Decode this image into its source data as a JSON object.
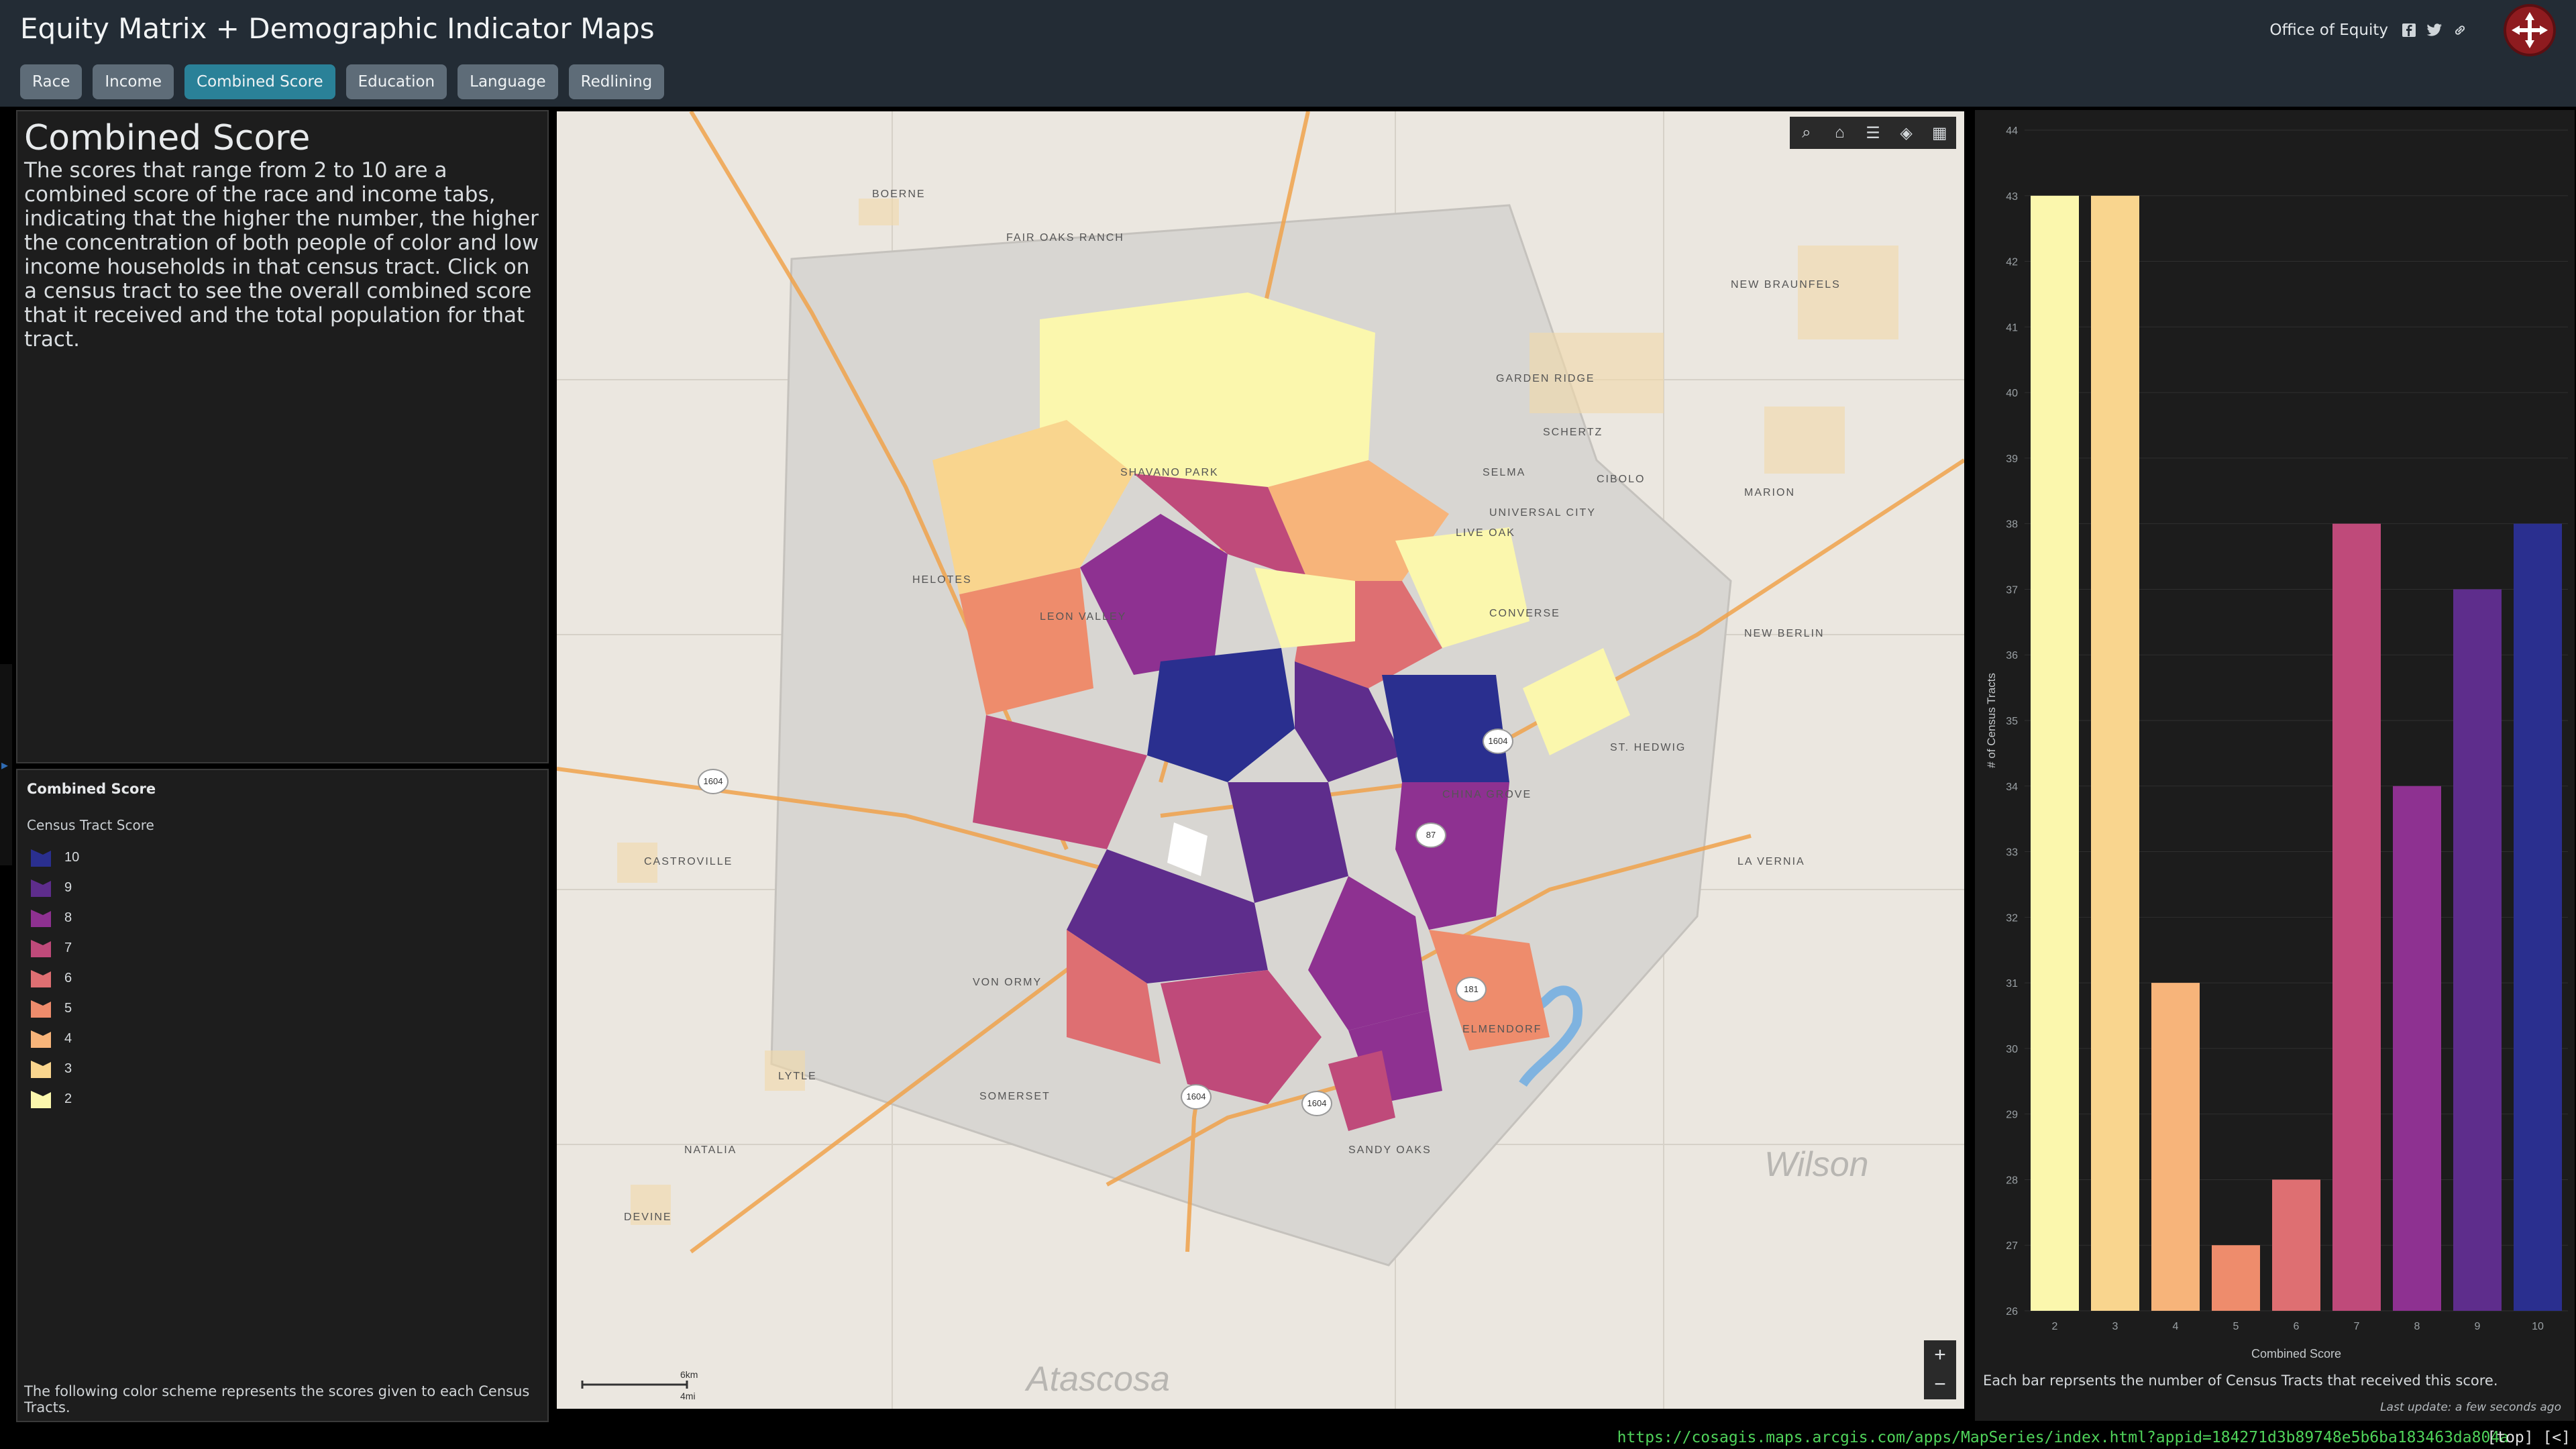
{
  "header": {
    "title": "Equity Matrix + Demographic Indicator Maps",
    "org": "Office of Equity",
    "tabs": [
      {
        "label": "Race"
      },
      {
        "label": "Income"
      },
      {
        "label": "Combined Score",
        "active": true
      },
      {
        "label": "Education"
      },
      {
        "label": "Language"
      },
      {
        "label": "Redlining"
      }
    ],
    "social_icons": [
      "facebook-icon",
      "twitter-icon",
      "link-icon"
    ]
  },
  "description": {
    "title": "Combined Score",
    "text": "The scores that range from 2 to 10 are a combined score of the race and income tabs, indicating that the higher the number, the higher the concentration of both people of color and low income households in that census tract. Click on a census tract to see the overall combined score that it received and the total population for that tract."
  },
  "legend": {
    "title": "Combined Score",
    "subtitle": "Census Tract Score",
    "items": [
      {
        "label": "10",
        "color": "#2a2f8f"
      },
      {
        "label": "9",
        "color": "#5e2d8c"
      },
      {
        "label": "8",
        "color": "#8e3191"
      },
      {
        "label": "7",
        "color": "#bf4a7a"
      },
      {
        "label": "6",
        "color": "#de6f72"
      },
      {
        "label": "5",
        "color": "#ee8c6c"
      },
      {
        "label": "4",
        "color": "#f7b47a"
      },
      {
        "label": "3",
        "color": "#f9d58e"
      },
      {
        "label": "2",
        "color": "#fbf7ad"
      }
    ],
    "footer": "The following color scheme represents the scores given to each Census Tracts."
  },
  "map": {
    "labels": [
      "BOERNE",
      "FAIR OAKS RANCH",
      "HELOTES",
      "SHAVANO PARK",
      "LEON VALLEY",
      "CASTROVILLE",
      "LYTLE",
      "NATALIA",
      "DEVINE",
      "SOMERSET",
      "VON ORMY",
      "SANDY OAKS",
      "ELMENDORF",
      "CHINA GROVE",
      "ST. HEDWIG",
      "CONVERSE",
      "LIVE OAK",
      "UNIVERSAL CITY",
      "SELMA",
      "SCHERTZ",
      "CIBOLO",
      "GARDEN RIDGE",
      "NEW BRAUNFELS",
      "MARION",
      "NEW BERLIN",
      "LA VERNIA"
    ],
    "county_labels": [
      "Wilson",
      "Atascosa"
    ],
    "highway_shields": [
      "1604",
      "1604",
      "1604",
      "1604",
      "181",
      "87"
    ],
    "scale": {
      "km": "6km",
      "mi": "4mi"
    },
    "toolbar": [
      "search-icon",
      "home-icon",
      "list-icon",
      "layers-icon",
      "basemap-icon"
    ],
    "zoom_in": "+",
    "zoom_out": "−"
  },
  "chart": {
    "note": "Each bar reprsents the number of Census Tracts that received this score.",
    "update": "Last update: a few seconds ago"
  },
  "chart_data": {
    "type": "bar",
    "categories": [
      "2",
      "3",
      "4",
      "5",
      "6",
      "7",
      "8",
      "9",
      "10"
    ],
    "values": [
      43,
      43,
      31,
      27,
      28,
      38,
      34,
      37,
      38
    ],
    "colors": [
      "#fbf7ad",
      "#f9d58e",
      "#f7b47a",
      "#ee8c6c",
      "#de6f72",
      "#bf4a7a",
      "#8e3191",
      "#5e2d8c",
      "#2a2f8f"
    ],
    "xlabel": "Combined Score",
    "ylabel": "# of Census Tracts",
    "ylim": [
      26,
      44
    ],
    "yticks": [
      26,
      27,
      28,
      29,
      30,
      31,
      32,
      33,
      34,
      35,
      36,
      37,
      38,
      39,
      40,
      41,
      42,
      43,
      44
    ],
    "grid": true
  },
  "status": {
    "url": "https://cosagis.maps.arcgis.com/apps/MapSeries/index.html?appid=184271d3b89748e5b6ba183463da804a",
    "right": "[top] [<]"
  }
}
